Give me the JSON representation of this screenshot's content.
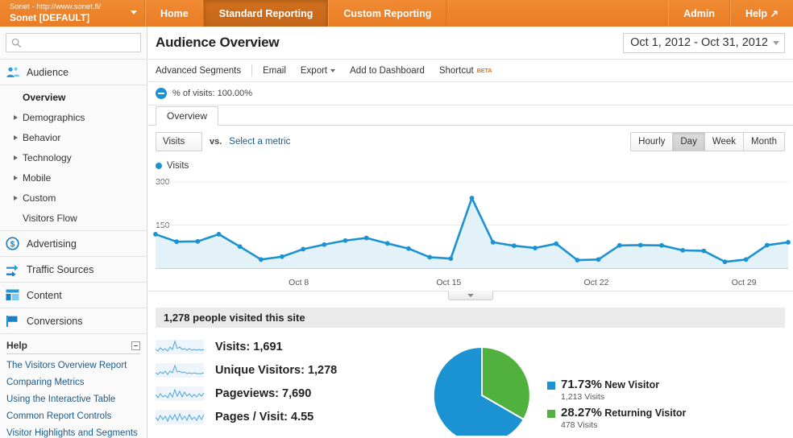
{
  "topbar": {
    "account": {
      "url": "Sonet - http://www.sonet.fi/",
      "name": "Sonet [DEFAULT]",
      "caret_icon": "chevron-down-icon"
    },
    "tabs": [
      {
        "label": "Home",
        "active": false
      },
      {
        "label": "Standard Reporting",
        "active": true
      },
      {
        "label": "Custom Reporting",
        "active": false
      }
    ],
    "right_links": [
      {
        "label": "Admin"
      },
      {
        "label": "Help ↗"
      }
    ],
    "brand_orange": "#e97c24",
    "active_tab_orange": "#c4661a"
  },
  "sidebar": {
    "search": {
      "placeholder": "",
      "value": "",
      "icon": "search-icon"
    },
    "groups": [
      {
        "label": "Audience",
        "icon": "audience-people-icon",
        "items": [
          {
            "label": "Overview",
            "expandable": false,
            "selected": true
          },
          {
            "label": "Demographics",
            "expandable": true,
            "selected": false
          },
          {
            "label": "Behavior",
            "expandable": true,
            "selected": false
          },
          {
            "label": "Technology",
            "expandable": true,
            "selected": false
          },
          {
            "label": "Mobile",
            "expandable": true,
            "selected": false
          },
          {
            "label": "Custom",
            "expandable": true,
            "selected": false
          },
          {
            "label": "Visitors Flow",
            "expandable": false,
            "selected": false
          }
        ]
      },
      {
        "label": "Advertising",
        "icon": "dollar-circle-icon",
        "items": []
      },
      {
        "label": "Traffic Sources",
        "icon": "arrows-icon",
        "items": []
      },
      {
        "label": "Content",
        "icon": "content-layout-icon",
        "items": []
      },
      {
        "label": "Conversions",
        "icon": "flag-icon",
        "items": []
      }
    ],
    "help": {
      "title": "Help",
      "collapse_icon": "collapse-icon",
      "links": [
        "The Visitors Overview Report",
        "Comparing Metrics",
        "Using the Interactive Table",
        "Common Report Controls",
        "Visitor Highlights and Segments"
      ]
    }
  },
  "main": {
    "page_title": "Audience Overview",
    "date_range": {
      "text": "Oct 1, 2012 - Oct 31, 2012",
      "caret_icon": "chevron-down-icon"
    },
    "toolbar": [
      {
        "label": "Advanced Segments",
        "separator_after": true
      },
      {
        "label": "Email",
        "separator_after": false
      },
      {
        "label": "Export",
        "caret": true,
        "separator_after": false
      },
      {
        "label": "Add to Dashboard",
        "separator_after": false
      },
      {
        "label": "Shortcut",
        "badge": "BETA",
        "separator_after": false
      }
    ],
    "segment_bar": {
      "icon": "segment-pie-icon",
      "label": "% of visits: 100.00%"
    },
    "tabs": [
      {
        "label": "Overview",
        "active": true
      }
    ],
    "metric_selector": {
      "value": "Visits",
      "caret_icon": "chevron-down-icon"
    },
    "vs_label": "vs.",
    "select_metric_link": "Select a metric",
    "granularity": [
      {
        "label": "Hourly",
        "active": false
      },
      {
        "label": "Day",
        "active": true
      },
      {
        "label": "Week",
        "active": false
      },
      {
        "label": "Month",
        "active": false
      }
    ],
    "chart_legend": {
      "label": "Visits",
      "color": "#1b92d1"
    },
    "drag_handle_icon": "chart-collapse-handle-icon",
    "summary_headline": "1,278 people visited this site",
    "metrics": [
      {
        "sparkline_icon": "sparkline-icon",
        "text": "Visits: 1,691"
      },
      {
        "sparkline_icon": "sparkline-icon",
        "text": "Unique Visitors: 1,278"
      },
      {
        "sparkline_icon": "sparkline-icon",
        "text": "Pageviews: 7,690"
      },
      {
        "sparkline_icon": "sparkline-icon",
        "text": "Pages / Visit: 4.55"
      }
    ],
    "visitor_pie": {
      "entries": [
        {
          "pct": "71.73%",
          "name": "New Visitor",
          "sub": "1,213 Visits",
          "color": "#1b92d1"
        },
        {
          "pct": "28.27%",
          "name": "Returning Visitor",
          "sub": "478 Visits",
          "color": "#51b13f"
        }
      ]
    }
  },
  "chart_data": {
    "type": "line",
    "title": "Visits",
    "xlabel": "",
    "ylabel": "Visits",
    "ylim": [
      0,
      300
    ],
    "yticks": [
      150,
      300
    ],
    "grid": true,
    "legend": "Visits",
    "series_color": "#1b92d1",
    "fill_color": "#e3f1f9",
    "tick_labels": [
      "Oct 8",
      "Oct 15",
      "Oct 22",
      "Oct 29"
    ],
    "tick_indices": [
      7,
      14,
      21,
      28
    ],
    "x": [
      "Oct 1",
      "Oct 2",
      "Oct 3",
      "Oct 4",
      "Oct 5",
      "Oct 6",
      "Oct 7",
      "Oct 8",
      "Oct 9",
      "Oct 10",
      "Oct 11",
      "Oct 12",
      "Oct 13",
      "Oct 14",
      "Oct 15",
      "Oct 16",
      "Oct 17",
      "Oct 18",
      "Oct 19",
      "Oct 20",
      "Oct 21",
      "Oct 22",
      "Oct 23",
      "Oct 24",
      "Oct 25",
      "Oct 26",
      "Oct 27",
      "Oct 28",
      "Oct 29",
      "Oct 30",
      "Oct 31"
    ],
    "series": [
      {
        "name": "Visits",
        "values": [
          118,
          92,
          93,
          118,
          75,
          30,
          40,
          66,
          82,
          96,
          105,
          86,
          68,
          38,
          33,
          244,
          90,
          78,
          70,
          85,
          28,
          30,
          79,
          80,
          79,
          62,
          60,
          22,
          30,
          80,
          90
        ]
      }
    ]
  }
}
